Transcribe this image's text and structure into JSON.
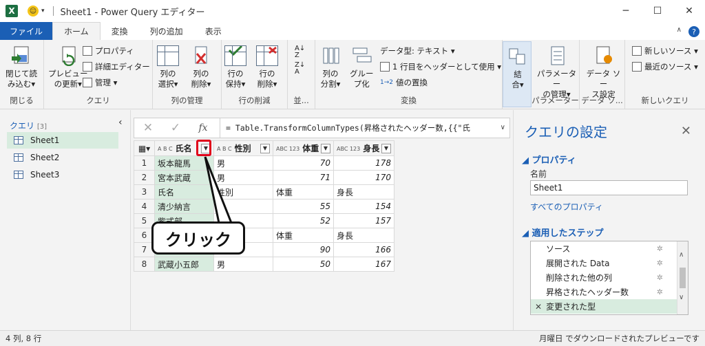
{
  "window": {
    "title": "Sheet1 - Power Query エディター",
    "app_icon": "X"
  },
  "tabs": [
    "ファイル",
    "ホーム",
    "変換",
    "列の追加",
    "表示"
  ],
  "ribbon": {
    "close_group": {
      "btn": "閉じて読\nみ込む▾",
      "label": "閉じる"
    },
    "query_group": {
      "refresh": "プレビュー\nの更新▾",
      "properties": "プロパティ",
      "advanced_editor": "詳細エディター",
      "manage": "管理 ▾",
      "label": "クエリ"
    },
    "columns_group": {
      "select": "列の\n選択▾",
      "remove": "列の\n削除▾",
      "label": "列の管理"
    },
    "rows_group": {
      "keep": "行の\n保持▾",
      "remove": "行の\n削除▾",
      "label": "行の削減"
    },
    "sort_group": {
      "label": "並..."
    },
    "transform_group": {
      "split": "列の\n分割▾",
      "group_by": "グルー\nプ化",
      "data_type": "データ型: テキスト ▾",
      "first_row": "1 行目をヘッダーとして使用 ▾",
      "replace": "値の置換",
      "label": "変換"
    },
    "combine_group": {
      "btn": "結\n合▾"
    },
    "params_group": {
      "btn": "パラメーター\nの管理▾",
      "label": "パラメーター"
    },
    "datasource_group": {
      "btn": "データ ソー\nス設定",
      "label": "データ ソ..."
    },
    "newquery_group": {
      "new_source": "新しいソース ▾",
      "recent": "最近のソース ▾",
      "label": "新しいクエリ"
    }
  },
  "query_pane": {
    "title": "クエリ",
    "count": "[3]",
    "items": [
      "Sheet1",
      "Sheet2",
      "Sheet3"
    ]
  },
  "formula_bar": {
    "formula": "= Table.TransformColumnTypes(昇格されたヘッダー数,{{\"氏"
  },
  "grid": {
    "columns": [
      {
        "type": "A B C",
        "name": "氏名"
      },
      {
        "type": "A B C",
        "name": "性別"
      },
      {
        "type": "ABC 123",
        "name": "体重"
      },
      {
        "type": "ABC 123",
        "name": "身長"
      }
    ],
    "rows": [
      [
        "1",
        "坂本龍馬",
        "男",
        "70",
        "178"
      ],
      [
        "2",
        "宮本武蔵",
        "男",
        "71",
        "170"
      ],
      [
        "3",
        "氏名",
        "性別",
        "体重",
        "身長"
      ],
      [
        "4",
        "清少納言",
        "女",
        "55",
        "154"
      ],
      [
        "5",
        "紫式部",
        "女",
        "52",
        "157"
      ],
      [
        "6",
        "氏名",
        "性別",
        "体重",
        "身長"
      ],
      [
        "7",
        "織田信長",
        "男",
        "90",
        "166"
      ],
      [
        "8",
        "武蔵小五郎",
        "男",
        "50",
        "167"
      ]
    ]
  },
  "callout": "クリック",
  "settings": {
    "title": "クエリの設定",
    "properties_section": "プロパティ",
    "name_label": "名前",
    "name_value": "Sheet1",
    "all_properties_link": "すべてのプロパティ",
    "steps_section": "適用したステップ",
    "steps": [
      "ソース",
      "展開された Data",
      "削除された他の列",
      "昇格されたヘッダー数",
      "変更された型"
    ]
  },
  "status": {
    "left": "4 列, 8 行",
    "right": "月曜日 でダウンロードされたプレビューです"
  },
  "colors": {
    "accent": "#1b5fb5",
    "selection": "#d8ecdf",
    "highlight": "#e0001a"
  }
}
